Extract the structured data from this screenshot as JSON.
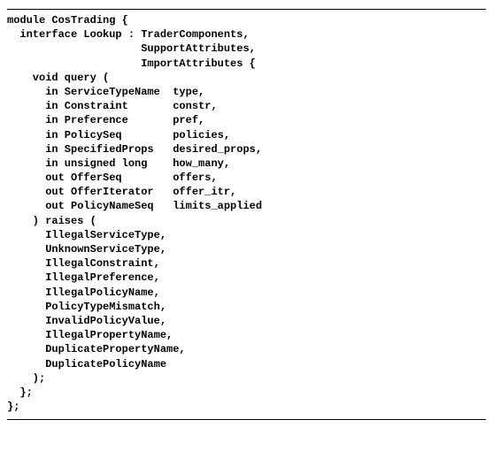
{
  "code": {
    "l01": "module CosTrading {",
    "l02": "  interface Lookup : TraderComponents,",
    "l03": "                     SupportAttributes,",
    "l04": "                     ImportAttributes {",
    "l05": "    void query (",
    "l06": "      in ServiceTypeName  type,",
    "l07": "      in Constraint       constr,",
    "l08": "      in Preference       pref,",
    "l09": "      in PolicySeq        policies,",
    "l10": "      in SpecifiedProps   desired_props,",
    "l11": "      in unsigned long    how_many,",
    "l12": "      out OfferSeq        offers,",
    "l13": "      out OfferIterator   offer_itr,",
    "l14": "      out PolicyNameSeq   limits_applied",
    "l15": "    ) raises (",
    "l16": "      IllegalServiceType,",
    "l17": "      UnknownServiceType,",
    "l18": "      IllegalConstraint,",
    "l19": "      IllegalPreference,",
    "l20": "      IllegalPolicyName,",
    "l21": "      PolicyTypeMismatch,",
    "l22": "      InvalidPolicyValue,",
    "l23": "      IllegalPropertyName,",
    "l24": "      DuplicatePropertyName,",
    "l25": "      DuplicatePolicyName",
    "l26": "    );",
    "l27": "  };",
    "l28": "};"
  }
}
